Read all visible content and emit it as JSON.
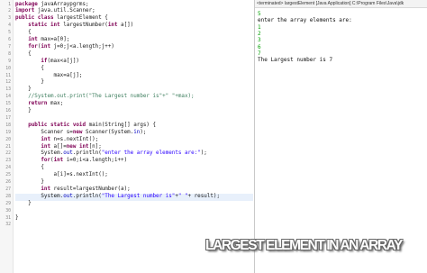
{
  "editor": {
    "lines": [
      {
        "n": "1",
        "t": "package javaArraypgrms;"
      },
      {
        "n": "2",
        "t": "import java.util.Scanner;"
      },
      {
        "n": "3",
        "t": "public class largestElement {"
      },
      {
        "n": "4",
        "t": "    static int largestNumber(int a[])"
      },
      {
        "n": "5",
        "t": "    {"
      },
      {
        "n": "6",
        "t": "    int max=a[0];"
      },
      {
        "n": "7",
        "t": "    for(int j=0;j<a.length;j++)"
      },
      {
        "n": "8",
        "t": "    {"
      },
      {
        "n": "9",
        "t": "        if(max<a[j])"
      },
      {
        "n": "10",
        "t": "        {"
      },
      {
        "n": "11",
        "t": "            max=a[j];"
      },
      {
        "n": "12",
        "t": "        }"
      },
      {
        "n": "13",
        "t": "    }"
      },
      {
        "n": "14",
        "t": "    //System.out.print(\"The Largest number is\"+\" \"+max);"
      },
      {
        "n": "15",
        "t": "    return max;"
      },
      {
        "n": "16",
        "t": "    }"
      },
      {
        "n": "17",
        "t": ""
      },
      {
        "n": "18",
        "t": "    public static void main(String[] args) {"
      },
      {
        "n": "19",
        "t": "        Scanner s=new Scanner(System.in);"
      },
      {
        "n": "20",
        "t": "        int n=s.nextInt();"
      },
      {
        "n": "21",
        "t": "        int a[]=new int[n];"
      },
      {
        "n": "22",
        "t": "        System.out.println(\"enter the array elements are:\");"
      },
      {
        "n": "23",
        "t": "        for(int i=0;i<a.length;i++)"
      },
      {
        "n": "24",
        "t": "        {"
      },
      {
        "n": "25",
        "t": "            a[i]=s.nextInt();"
      },
      {
        "n": "26",
        "t": "        }"
      },
      {
        "n": "27",
        "t": "        int result=largestNumber(a);"
      },
      {
        "n": "28",
        "t": "        System.out.println(\"The Largest number is\"+\" \"+ result);"
      },
      {
        "n": "29",
        "t": "    }"
      },
      {
        "n": "30",
        "t": ""
      },
      {
        "n": "31",
        "t": "}"
      },
      {
        "n": "32",
        "t": ""
      }
    ]
  },
  "console": {
    "header": "<terminated> largestElement [Java Application] C:\\Program Files\\Java\\jdk",
    "lines": [
      {
        "t": "5",
        "kind": "in"
      },
      {
        "t": "enter the array elements are:",
        "kind": "out"
      },
      {
        "t": "1",
        "kind": "in"
      },
      {
        "t": "2",
        "kind": "in"
      },
      {
        "t": "3",
        "kind": "in"
      },
      {
        "t": "6",
        "kind": "in"
      },
      {
        "t": "7",
        "kind": "in"
      },
      {
        "t": "The Largest number is 7",
        "kind": "out"
      }
    ]
  },
  "caption": "LARGEST ELEMENT IN AN ARRAY",
  "colors": {
    "keyword": "#7f0055",
    "string": "#2a00ff",
    "comment": "#3f7f5f",
    "field": "#0000c0",
    "console_input": "#00a000"
  }
}
